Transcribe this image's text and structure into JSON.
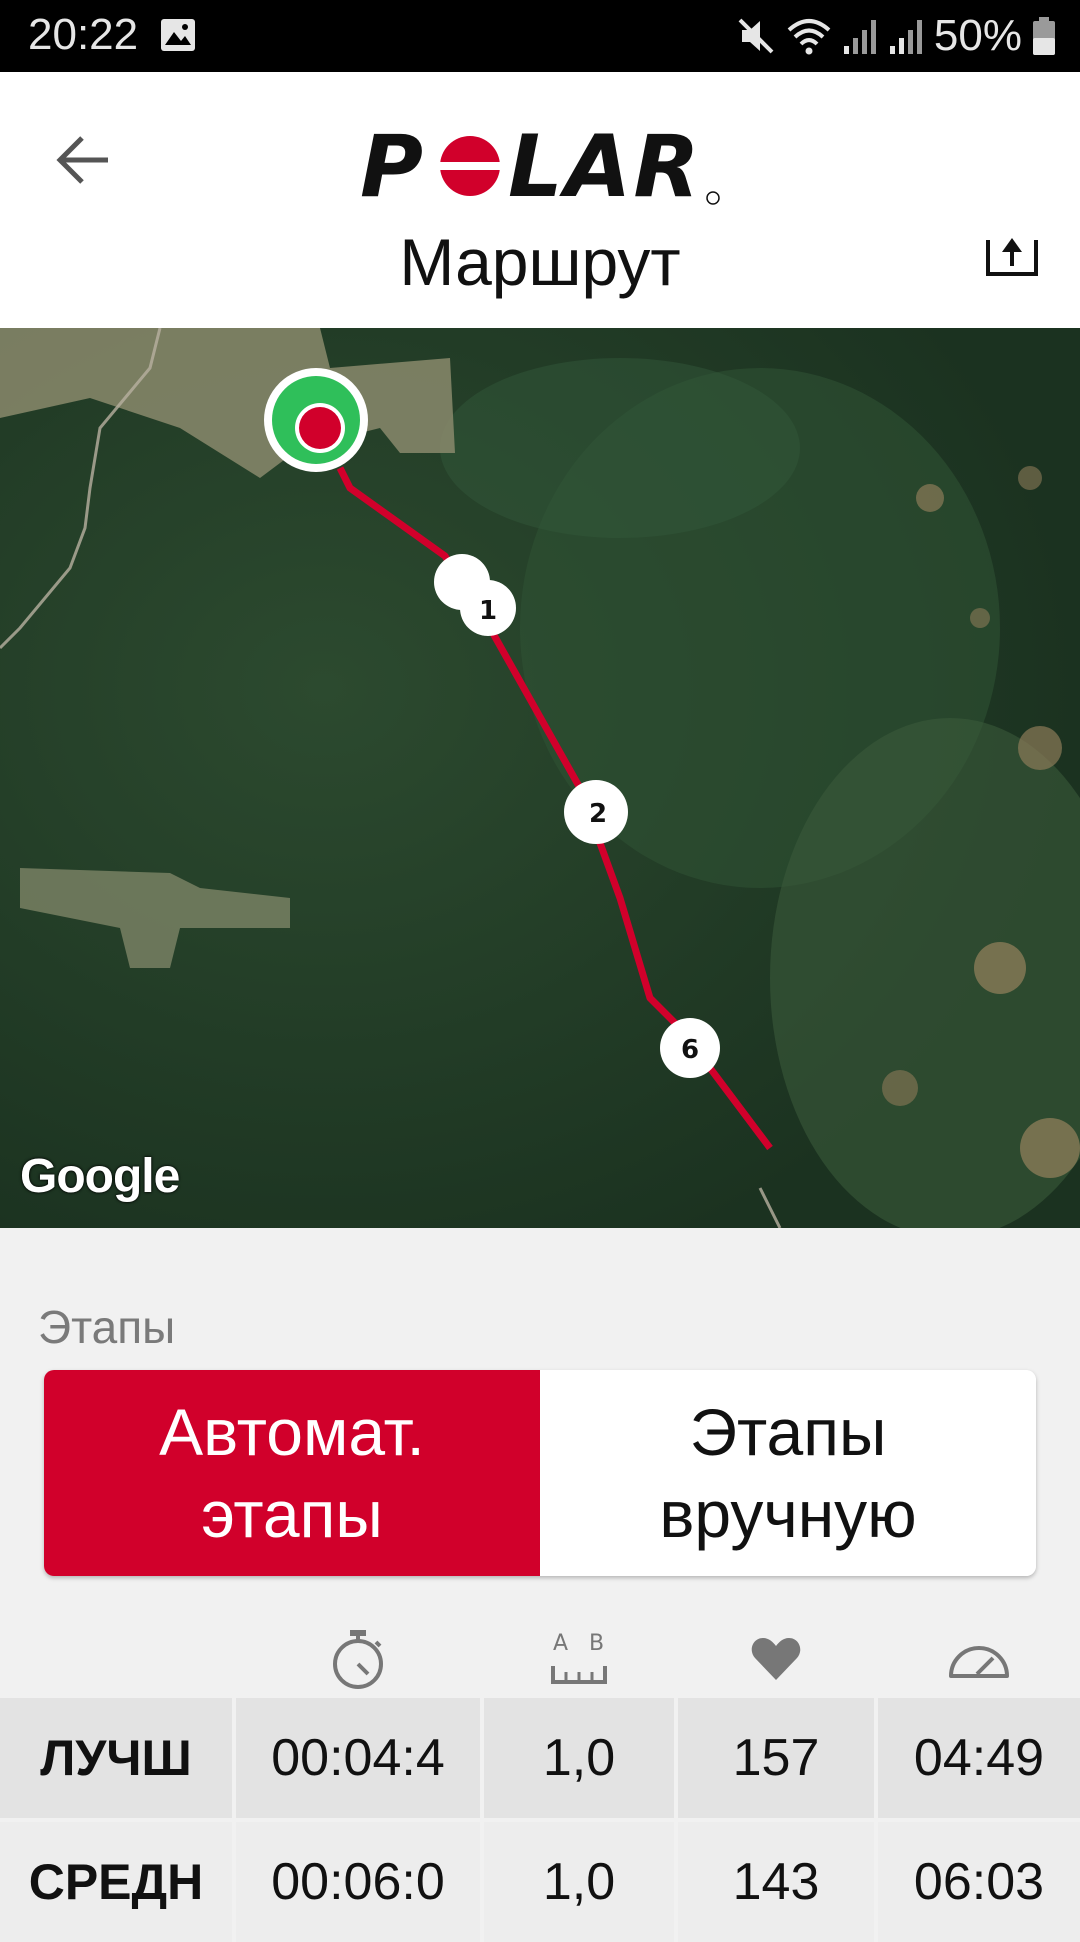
{
  "status_bar": {
    "time": "20:22",
    "battery": "50%",
    "icons": [
      "image-icon",
      "mute-icon",
      "wifi-icon",
      "signal-icon",
      "signal-icon",
      "battery-icon"
    ]
  },
  "header": {
    "logo_text": "POLAR",
    "title": "Маршрут",
    "back_icon": "arrow-left-icon",
    "export_icon": "export-icon"
  },
  "map": {
    "attribution": "Google",
    "lap_markers": [
      "1",
      "2",
      "6"
    ],
    "colors": {
      "route": "#d1002b",
      "start_outer": "#2fbf5a",
      "start_inner": "#d1002b"
    }
  },
  "laps": {
    "section_label": "Этапы",
    "tabs": [
      {
        "label": "Автомат.\nэтапы",
        "active": true
      },
      {
        "label": "Этапы\nвручную",
        "active": false
      }
    ],
    "column_icons": [
      "stopwatch-icon",
      "distance-icon",
      "heart-icon",
      "speedometer-icon"
    ],
    "rows": [
      {
        "label": "ЛУЧШ",
        "time": "00:04:4",
        "distance": "1,0",
        "heart_rate": "157",
        "pace": "04:49"
      },
      {
        "label": "СРЕДН",
        "time": "00:06:0",
        "distance": "1,0",
        "heart_rate": "143",
        "pace": "06:03"
      }
    ]
  },
  "colors": {
    "accent": "#d1002b",
    "background": "#f1f1f1"
  }
}
